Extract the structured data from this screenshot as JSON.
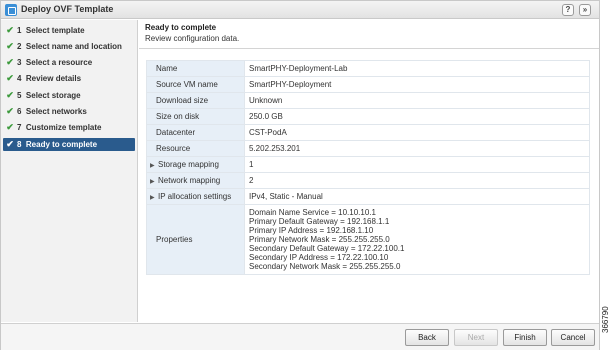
{
  "window": {
    "title": "Deploy OVF Template",
    "help_icon": "?",
    "restore_icon": "»"
  },
  "steps": [
    {
      "num": "1",
      "label": "Select template",
      "done": true
    },
    {
      "num": "2",
      "label": "Select name and location",
      "done": true
    },
    {
      "num": "3",
      "label": "Select a resource",
      "done": true
    },
    {
      "num": "4",
      "label": "Review details",
      "done": true
    },
    {
      "num": "5",
      "label": "Select storage",
      "done": true
    },
    {
      "num": "6",
      "label": "Select networks",
      "done": true
    },
    {
      "num": "7",
      "label": "Customize template",
      "done": true
    },
    {
      "num": "8",
      "label": "Ready to complete",
      "done": true,
      "active": true
    }
  ],
  "content": {
    "title": "Ready to complete",
    "subtitle": "Review configuration data."
  },
  "review": {
    "name": {
      "label": "Name",
      "value": "SmartPHY-Deployment-Lab"
    },
    "source_vm": {
      "label": "Source VM name",
      "value": "SmartPHY-Deployment"
    },
    "download_size": {
      "label": "Download size",
      "value": "Unknown"
    },
    "disk_size": {
      "label": "Size on disk",
      "value": "250.0 GB"
    },
    "datacenter": {
      "label": "Datacenter",
      "value": "CST-PodA"
    },
    "resource": {
      "label": "Resource",
      "value": "5.202.253.201"
    },
    "storage_mapping": {
      "label": "Storage mapping",
      "value": "1"
    },
    "network_mapping": {
      "label": "Network mapping",
      "value": "2"
    },
    "ip_allocation": {
      "label": "IP allocation settings",
      "value": "IPv4, Static - Manual"
    },
    "properties": {
      "label": "Properties",
      "lines": [
        "Domain Name Service = 10.10.10.1",
        "Primary Default Gateway = 192.168.1.1",
        "Primary IP Address = 192.168.1.10",
        "Primary Network Mask = 255.255.255.0",
        "Secondary Default Gateway = 172.22.100.1",
        "Secondary IP Address = 172.22.100.10",
        "Secondary Network Mask = 255.255.255.0"
      ]
    }
  },
  "footer": {
    "back": "Back",
    "next": "Next",
    "finish": "Finish",
    "cancel": "Cancel"
  },
  "figure_id": "366790"
}
